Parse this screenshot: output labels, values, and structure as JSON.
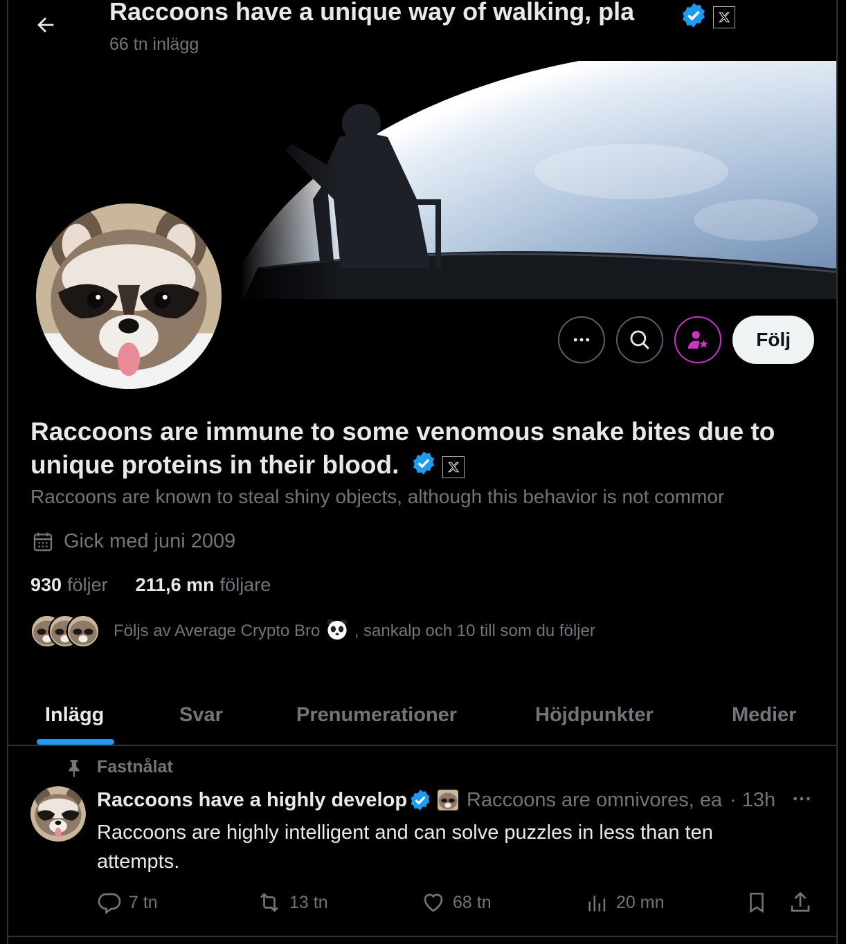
{
  "header": {
    "title": "Raccoons have a unique way of walking, pla",
    "subtitle": "66 tn inlägg"
  },
  "profile": {
    "display_name": "Raccoons are immune to some venomous snake bites due to unique proteins in their blood.",
    "bio": "Raccoons are known to steal shiny objects, although this behavior is not commor",
    "joined": "Gick med juni 2009",
    "following_count": "930",
    "following_label": "följer",
    "followers_count": "211,6 mn",
    "followers_label": "följare",
    "followed_by_pre": "Följs av Average Crypto Bro",
    "followed_by_post": ", sankalp och 10 till som du följer"
  },
  "actions": {
    "follow_label": "Följ"
  },
  "tabs": [
    {
      "label": "Inlägg",
      "active": true
    },
    {
      "label": "Svar",
      "active": false
    },
    {
      "label": "Prenumerationer",
      "active": false
    },
    {
      "label": "Höjdpunkter",
      "active": false
    },
    {
      "label": "Medier",
      "active": false
    }
  ],
  "post": {
    "pinned_label": "Fastnålat",
    "author_name": "Raccoons have a highly develop",
    "author_handle": "Raccoons are omnivores, ea",
    "time": "· 13h",
    "text": "Raccoons are highly intelligent and can solve puzzles in less than ten attempts.",
    "replies": "7 tn",
    "reposts": "13 tn",
    "likes": "68 tn",
    "views": "20 mn"
  },
  "colors": {
    "accent": "#1d9bf0",
    "verified": "#1d9bf0",
    "subscribe": "#c936c7",
    "muted": "#71767b"
  }
}
